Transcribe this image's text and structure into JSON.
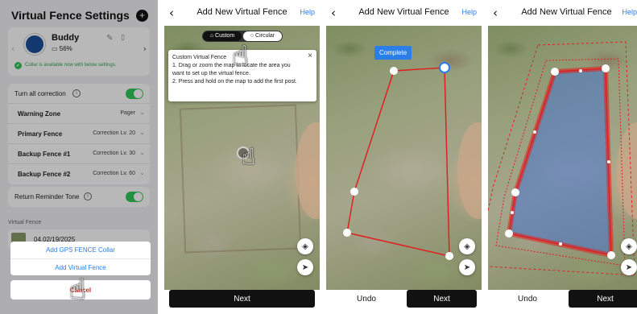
{
  "settings": {
    "title": "Virtual Fence Settings",
    "plus_icon": "+",
    "pet_name": "Buddy",
    "battery": "56%",
    "collar_status": "Collar is available now with below settings.",
    "correction_label": "Turn all correction",
    "info_icon": "i",
    "rows": [
      {
        "label": "Warning Zone",
        "value": "Pager"
      },
      {
        "label": "Primary Fence",
        "value": "Correction Lv. 20"
      },
      {
        "label": "Backup Fence #1",
        "value": "Correction Lv. 30"
      },
      {
        "label": "Backup Fence #2",
        "value": "Correction Lv. 60"
      }
    ],
    "reminder_label": "Return Reminder Tone",
    "virtual_fence_header": "Virtual Fence",
    "fence_date": "04.02/19/2025",
    "sheet": {
      "add_collar": "Add GPS FENCE Collar",
      "add_fence": "Add Virtual Fence",
      "cancel": "Cancel"
    }
  },
  "nav": {
    "title": "Add New Virtual Fence",
    "help": "Help",
    "back": "‹"
  },
  "mode_toggle": {
    "custom": "Custom",
    "circular": "Circular"
  },
  "tooltip": {
    "heading": "Custom Virtual Fence",
    "line1": "1. Drag or zoom the map to locate the area you want to set up the virtual fence.",
    "line2": "2. Press and hold on the map to add the first post.",
    "close": "×"
  },
  "complete_label": "Complete",
  "buttons": {
    "next": "Next",
    "undo": "Undo"
  },
  "icons": {
    "hand": "☝",
    "layers": "◈",
    "locate": "➤",
    "pencil": "✎",
    "trash": "🗑",
    "chev": "›",
    "check": "✔"
  },
  "colors": {
    "accent": "#2b7de9",
    "toggle_on": "#34c759",
    "fence_line": "#e02020",
    "fence_fill": "#3d6fd6"
  }
}
